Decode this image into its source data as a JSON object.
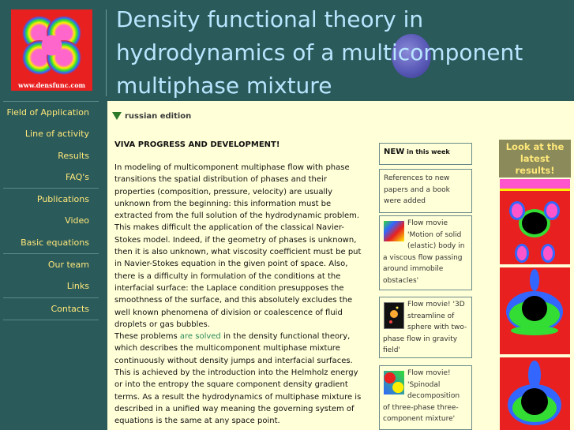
{
  "header": {
    "logo_url_text": "www.densfunc.com",
    "title_lines": [
      "Density functional theory in",
      "hydrodynamics of a multicomponent",
      "multiphase mixture"
    ]
  },
  "nav": {
    "items": [
      {
        "label": "Field of Application"
      },
      {
        "label": "Line of activity"
      },
      {
        "label": "Results"
      },
      {
        "label": "FAQ's"
      },
      {
        "label": "Publications"
      },
      {
        "label": "Video"
      },
      {
        "label": "Basic equations"
      },
      {
        "label": "Our team"
      },
      {
        "label": "Links"
      },
      {
        "label": "Contacts"
      }
    ]
  },
  "main": {
    "russian_edition": "russian edition",
    "heading": "VIVA PROGRESS AND DEVELOPMENT!",
    "paragraph1": "In modeling of multicomponent multiphase flow with phase transitions the spatial distribution of phases and their properties (composition, pressure, velocity) are usually unknown from the beginning: this information must be extracted from the full solution of the hydrodynamic problem. This makes difficult the application of the classical Navier-Stokes model. Indeed, if the geometry of phases is unknown, then it is also unknown, what viscosity coefficient must be put in Navier-Stokes equation in the given point of space. Also, there is a difficulty in formulation of the conditions at the interfacial surface: the Laplace condition presupposes the smoothness of the surface, and this absolutely excludes the well known phenomena of division or coalescence of fluid droplets or gas bubbles.",
    "p2_before": "These problems ",
    "p2_link": "are solved",
    "p2_after": " in the density functional theory, which describes the multicomponent multiphase mixture continuously without density jumps and interfacial surfaces. This is achieved by the introduction into the Helmholz energy or into the entropy the square component density gradient terms. As a result the hydrodynamics of multiphase mixture is described in a unified way meaning the governing system of equations is the same at any space point."
  },
  "news": {
    "new_label": "NEW",
    "in_this_week": "in this week",
    "items": [
      {
        "text": "References to new papers and a book were added"
      },
      {
        "text": "Flow movie 'Motion of solid (elastic) body in a viscous flow passing around immobile obstacles'"
      },
      {
        "text": "Flow movie! '3D streamline of sphere with two-phase flow in gravity field'"
      },
      {
        "text": "Flow movie! 'Spinodal decomposition of three-phase three-component mixture'"
      }
    ]
  },
  "latest": {
    "heading": "Look at the latest results!"
  },
  "colors": {
    "header_bg": "#2a5a5a",
    "title_text": "#b8e6ff",
    "nav_text": "#ffe87a",
    "content_bg": "#ffffd8",
    "link": "#2a8a5a",
    "logo_red": "#e82020"
  }
}
